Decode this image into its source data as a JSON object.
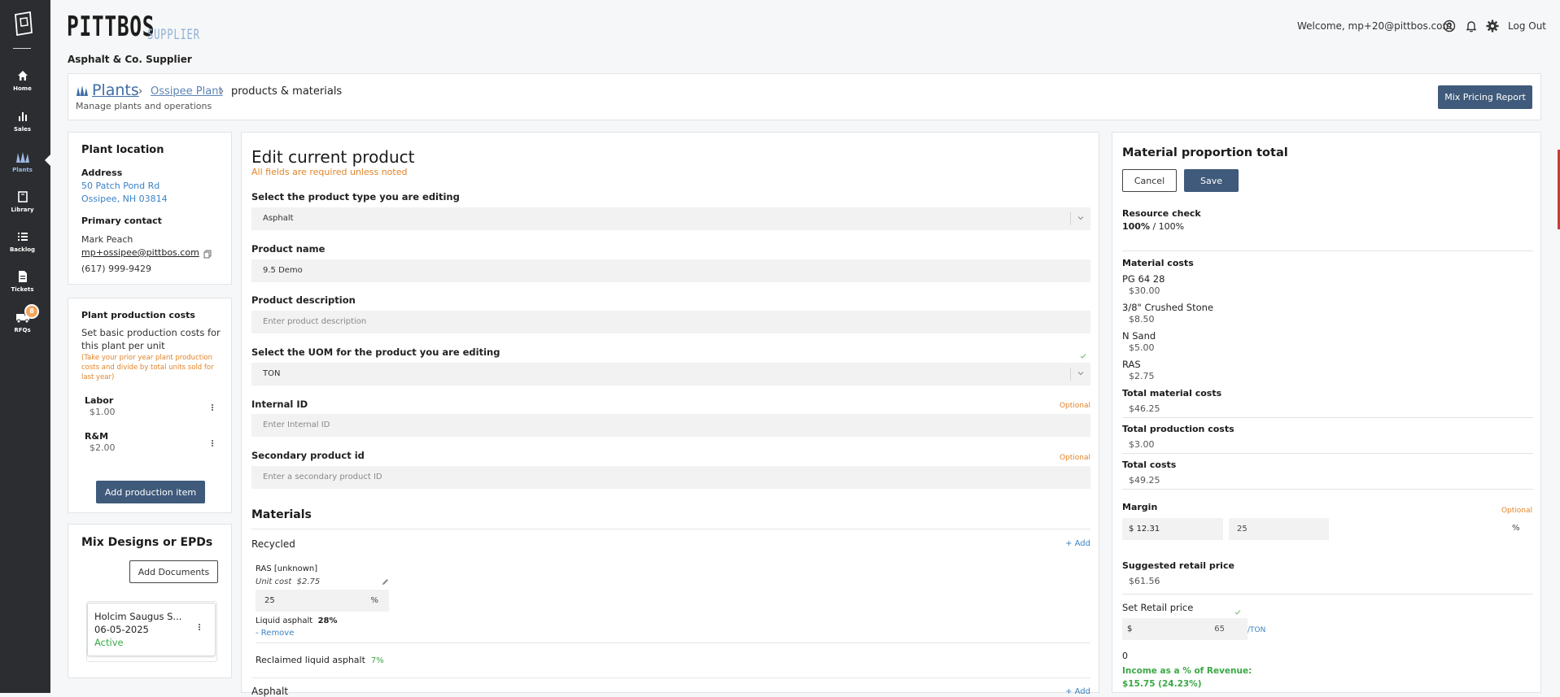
{
  "nav": {
    "items": [
      {
        "label": "Home",
        "icon": "home-icon"
      },
      {
        "label": "Sales",
        "icon": "bar-chart-icon"
      },
      {
        "label": "Plants",
        "icon": "plant-building-icon"
      },
      {
        "label": "Library",
        "icon": "library-icon"
      },
      {
        "label": "Backlog",
        "icon": "list-icon"
      },
      {
        "label": "Tickets",
        "icon": "ticket-icon"
      },
      {
        "label": "RFQs",
        "icon": "truck-icon"
      }
    ],
    "rfq_badge": "8"
  },
  "brand": {
    "name": "PITTBOS",
    "suffix": "SUPPLIER"
  },
  "header": {
    "company": "Asphalt & Co. Supplier",
    "welcome": "Welcome, mp+20@pittbos.com",
    "logout": "Log Out"
  },
  "breadcrumb": {
    "root": "Plants",
    "plant": "Ossipee Plant",
    "page": "products & materials",
    "subtitle": "Manage plants and operations",
    "mix_pricing_button": "Mix Pricing Report"
  },
  "plant_location": {
    "title": "Plant location",
    "address_label": "Address",
    "address_line1": "50 Patch Pond Rd",
    "address_line2": "Ossipee, NH 03814",
    "contact_label": "Primary contact",
    "contact_name": "Mark Peach",
    "contact_email": "mp+ossipee@pittbos.com",
    "contact_phone": "(617) 999-9429"
  },
  "production_costs": {
    "title": "Plant production costs",
    "description": "Set basic production costs for this plant per unit",
    "note": "(Take your prior year plant production costs and divide by total units sold for last year)",
    "items": [
      {
        "label": "Labor",
        "value": "$1.00"
      },
      {
        "label": "R&M",
        "value": "$2.00"
      }
    ],
    "add_button": "Add production item"
  },
  "mix_designs": {
    "title": "Mix Designs or EPDs",
    "add_button": "Add Documents",
    "doc": {
      "name": "Holcim Saugus S...",
      "date": "06-05-2025",
      "status": "Active"
    }
  },
  "edit": {
    "title": "Edit current product",
    "required_note": "All fields are required unless noted",
    "type_label": "Select the product type you are editing",
    "type_value": "Asphalt",
    "name_label": "Product name",
    "name_value": "9.5 Demo",
    "desc_label": "Product description",
    "desc_placeholder": "Enter product description",
    "uom_label": "Select the UOM for the product you are editing",
    "uom_value": "TON",
    "internal_label": "Internal ID",
    "internal_placeholder": "Enter Internal ID",
    "secondary_label": "Secondary product id",
    "secondary_placeholder": "Enter a secondary product ID",
    "optional": "Optional",
    "materials_title": "Materials",
    "recycled_label": "Recycled",
    "add_link": "+ Add",
    "ras_name": "RAS [unknown]",
    "ras_unit_cost_label": "Unit cost",
    "ras_unit_cost": "$2.75",
    "ras_pct": "25",
    "pct_symbol": "%",
    "liquid_label": "Liquid asphalt",
    "liquid_pct": "28%",
    "remove_link": "- Remove",
    "reclaimed_label": "Reclaimed liquid asphalt",
    "reclaimed_pct": "7%",
    "asphalt_label": "Asphalt"
  },
  "costs": {
    "title": "Material proportion total",
    "cancel": "Cancel",
    "save": "Save",
    "resource_label": "Resource check",
    "resource_value": "100%",
    "resource_total": "/ 100%",
    "material_costs_label": "Material costs",
    "materials": [
      {
        "name": "PG 64 28",
        "value": "$30.00"
      },
      {
        "name": "3/8\" Crushed Stone",
        "value": "$8.50"
      },
      {
        "name": "N Sand",
        "value": "$5.00"
      },
      {
        "name": "RAS",
        "value": "$2.75"
      }
    ],
    "total_material_label": "Total material costs",
    "total_material": "$46.25",
    "total_production_label": "Total production costs",
    "total_production": "$3.00",
    "total_costs_label": "Total costs",
    "total_costs": "$49.25",
    "margin_label": "Margin",
    "optional": "Optional",
    "margin_dollar_symbol": "$",
    "margin_dollar": "12.31",
    "margin_pct": "25",
    "pct_symbol": "%",
    "suggested_label": "Suggested retail price",
    "suggested_value": "$61.56",
    "retail_label": "Set Retail price",
    "retail_dollar_symbol": "$",
    "retail_value": "65",
    "retail_unit": "/TON",
    "zero_value": "0",
    "income_label": "Income as a % of Revenue:",
    "income_value": "$15.75 (24.23%)"
  },
  "colors": {
    "sidebar": "#2b2d30",
    "primary_button": "#3f5a7a",
    "link": "#3a82c4",
    "warning": "#e1842a",
    "success": "#3aa845"
  }
}
